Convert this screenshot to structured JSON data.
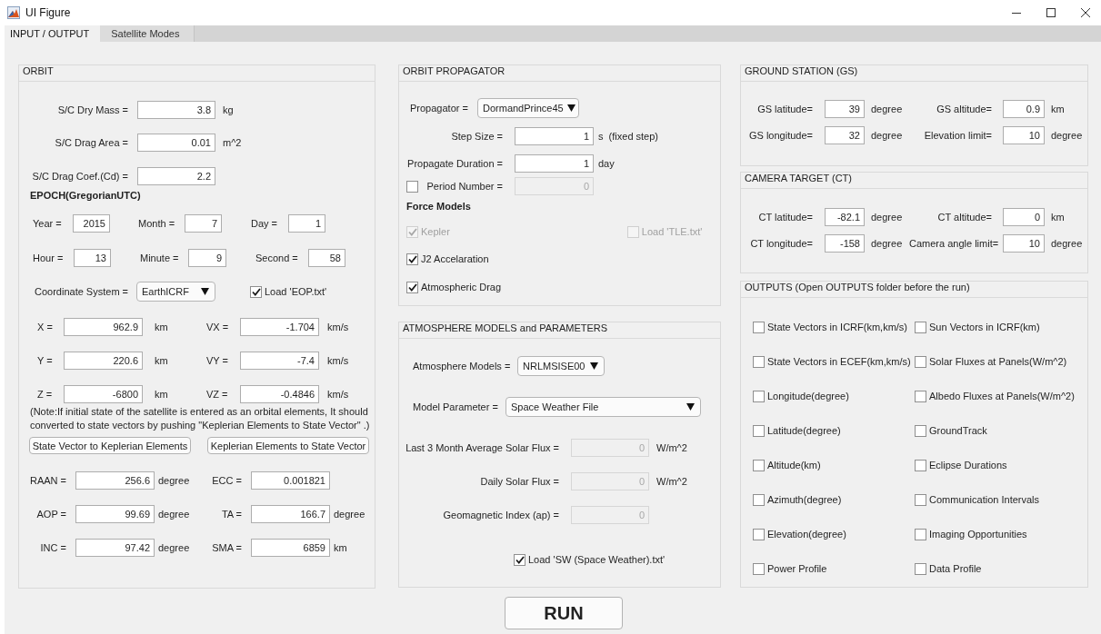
{
  "window": {
    "title": "UI Figure"
  },
  "tabs": [
    {
      "label": "INPUT / OUTPUT",
      "selected": true
    },
    {
      "label": "Satellite Modes",
      "selected": false
    }
  ],
  "orbit": {
    "title": "ORBIT",
    "spacecraft": [
      {
        "label": "S/C Dry Mass =",
        "value": "3.8",
        "unit": "kg"
      },
      {
        "label": "S/C Drag Area =",
        "value": "0.01",
        "unit": "m^2"
      },
      {
        "label": "S/C Drag Coef.(Cd) =",
        "value": "2.2"
      }
    ],
    "epoch_title": "EPOCH(GregorianUTC)",
    "epoch": [
      {
        "label": "Year =",
        "value": "2015"
      },
      {
        "label": "Month =",
        "value": "7"
      },
      {
        "label": "Day =",
        "value": "1"
      },
      {
        "label": "Hour =",
        "value": "13"
      },
      {
        "label": "Minute =",
        "value": "9"
      },
      {
        "label": "Second =",
        "value": "58"
      }
    ],
    "coordinate_system": {
      "label": "Coordinate System =",
      "value": "EarthICRF"
    },
    "load_eop": {
      "label": "Load 'EOP.txt'",
      "checked": true
    },
    "state_vector": [
      {
        "label": "X =",
        "value": "962.9",
        "unit": "km"
      },
      {
        "label": "VX =",
        "value": "-1.704",
        "unit": "km/s"
      },
      {
        "label": "Y =",
        "value": "220.6",
        "unit": "km"
      },
      {
        "label": "VY =",
        "value": "-7.4",
        "unit": "km/s"
      },
      {
        "label": "Z =",
        "value": "-6800",
        "unit": "km"
      },
      {
        "label": "VZ =",
        "value": "-0.4846",
        "unit": "km/s"
      }
    ],
    "note": "(Note:If initial state of the satellite is entered as an orbital elements, It should converted to state vectors by pushing \"Keplerian Elements to State Vector\" .)",
    "buttons": [
      "State Vector to Keplerian Elements",
      "Keplerian Elements to State Vector"
    ],
    "elements": [
      {
        "label": "RAAN =",
        "value": "256.6",
        "unit": "degree"
      },
      {
        "label": "ECC =",
        "value": "0.001821"
      },
      {
        "label": "AOP =",
        "value": "99.69",
        "unit": "degree"
      },
      {
        "label": "TA =",
        "value": "166.7",
        "unit": "degree"
      },
      {
        "label": "INC =",
        "value": "97.42",
        "unit": "degree"
      },
      {
        "label": "SMA =",
        "value": "6859",
        "unit": "km"
      }
    ]
  },
  "propagator": {
    "title": "ORBIT PROPAGATOR",
    "propagator": {
      "label": "Propagator =",
      "value": "DormandPrince45"
    },
    "fields": [
      {
        "label": "Step Size =",
        "value": "1",
        "unit": "s  (fixed step)",
        "disabled": false
      },
      {
        "label": "Propagate Duration =",
        "value": "1",
        "unit": "day",
        "disabled": false
      },
      {
        "label": "Period Number =",
        "value": "0",
        "disabled": true
      }
    ],
    "period_checkbox": {
      "checked": false
    },
    "force_models_title": "Force Models",
    "force_models": [
      {
        "label": "Kepler",
        "checked": true,
        "disabled": true
      },
      {
        "label": "Load 'TLE.txt'",
        "checked": false,
        "disabled": true
      },
      {
        "label": "J2 Accelaration",
        "checked": true,
        "disabled": false
      },
      {
        "label": "Atmospheric Drag",
        "checked": true,
        "disabled": false
      }
    ]
  },
  "atmosphere": {
    "title": "ATMOSPHERE MODELS and PARAMETERS",
    "model": {
      "label": "Atmosphere Models =",
      "value": "NRLMSISE00"
    },
    "parameter": {
      "label": "Model Parameter =",
      "value": "Space Weather File"
    },
    "fields": [
      {
        "label": "Last 3 Month Average Solar Flux =",
        "value": "0",
        "unit": "W/m^2",
        "disabled": true
      },
      {
        "label": "Daily Solar Flux =",
        "value": "0",
        "unit": "W/m^2",
        "disabled": true
      },
      {
        "label": "Geomagnetic Index (ap) =",
        "value": "0",
        "disabled": true
      }
    ],
    "load_sw": {
      "label": "Load 'SW (Space Weather).txt'",
      "checked": true
    }
  },
  "run_button": "RUN",
  "ground_station": {
    "title": "GROUND STATION (GS)",
    "fields": [
      {
        "label": "GS latitude=",
        "value": "39",
        "unit": "degree"
      },
      {
        "label": "GS altitude=",
        "value": "0.9",
        "unit": "km"
      },
      {
        "label": "GS longitude=",
        "value": "32",
        "unit": "degree"
      },
      {
        "label": "Elevation limit=",
        "value": "10",
        "unit": "degree"
      }
    ]
  },
  "camera_target": {
    "title": "CAMERA TARGET (CT)",
    "fields": [
      {
        "label": "CT latitude=",
        "value": "-82.1",
        "unit": "degree"
      },
      {
        "label": "CT altitude=",
        "value": "0",
        "unit": "km"
      },
      {
        "label": "CT longitude=",
        "value": "-158",
        "unit": "degree"
      },
      {
        "label": "Camera angle limit=",
        "value": "10",
        "unit": "degree"
      }
    ]
  },
  "outputs": {
    "title": "OUTPUTS (Open OUTPUTS folder before the run)",
    "options": [
      {
        "label": "State Vectors in ICRF(km,km/s)",
        "checked": false
      },
      {
        "label": "Sun Vectors in ICRF(km)",
        "checked": false
      },
      {
        "label": "State Vectors in ECEF(km,km/s)",
        "checked": false
      },
      {
        "label": "Solar Fluxes at Panels(W/m^2)",
        "checked": false
      },
      {
        "label": "Longitude(degree)",
        "checked": false
      },
      {
        "label": "Albedo Fluxes at Panels(W/m^2)",
        "checked": false
      },
      {
        "label": "Latitude(degree)",
        "checked": false
      },
      {
        "label": "GroundTrack",
        "checked": false
      },
      {
        "label": "Altitude(km)",
        "checked": false
      },
      {
        "label": "Eclipse Durations",
        "checked": false
      },
      {
        "label": "Azimuth(degree)",
        "checked": false
      },
      {
        "label": "Communication Intervals",
        "checked": false
      },
      {
        "label": "Elevation(degree)",
        "checked": false
      },
      {
        "label": "Imaging Opportunities",
        "checked": false
      },
      {
        "label": "Power Profile",
        "checked": false
      },
      {
        "label": "Data Profile",
        "checked": false
      }
    ]
  }
}
